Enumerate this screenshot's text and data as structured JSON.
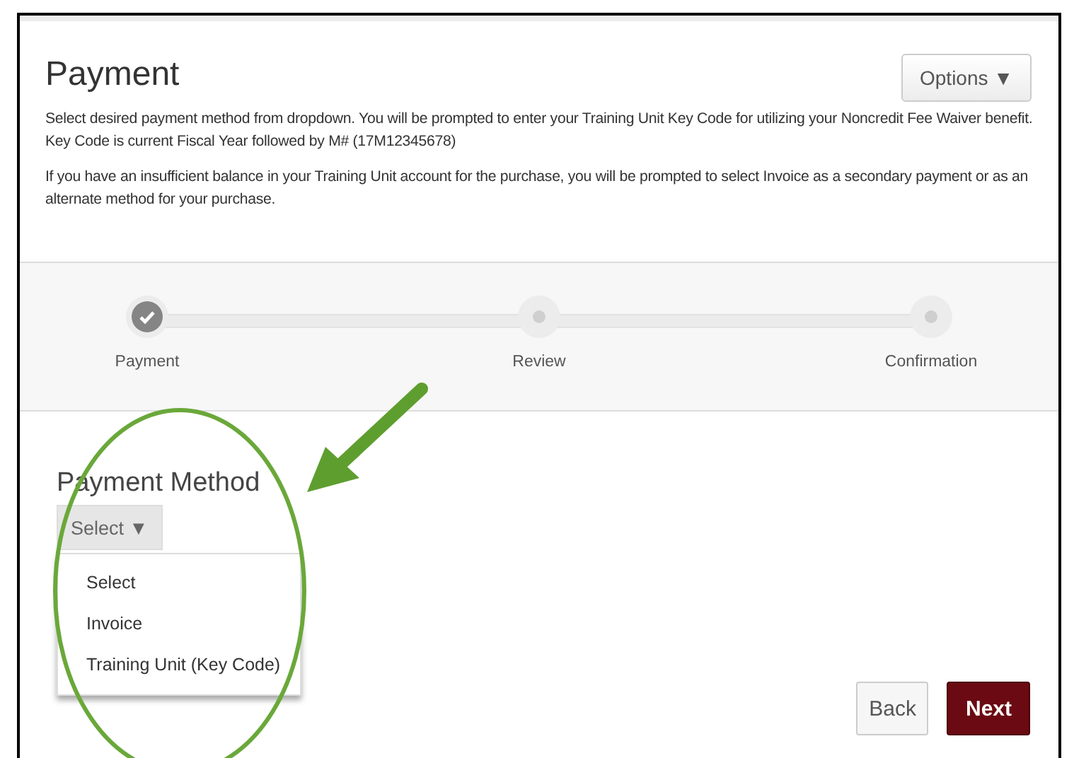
{
  "page": {
    "title": "Payment",
    "options_button": "Options ▼"
  },
  "description": [
    " Select desired payment method from  dropdown. You will be prompted to enter your Training Unit Key Code for utilizing your Noncredit Fee Waiver benefit. Key Code is current Fiscal Year followed by M# (17M12345678)",
    "If you have an insufficient balance in your Training Unit account for the purchase, you will be prompted to select Invoice as a secondary payment or as an alternate method for your purchase."
  ],
  "steps": [
    {
      "label": "Payment",
      "completed": true
    },
    {
      "label": "Review",
      "completed": false
    },
    {
      "label": "Confirmation",
      "completed": false
    }
  ],
  "payment_method": {
    "label": "Payment Method",
    "select_button": "Select ▼",
    "expanded": true,
    "options": [
      "Select",
      "Invoice",
      "Training Unit (Key Code)"
    ]
  },
  "buttons": [
    {
      "label": "Back",
      "kind": "secondary"
    },
    {
      "label": "Next",
      "kind": "primary"
    }
  ]
}
